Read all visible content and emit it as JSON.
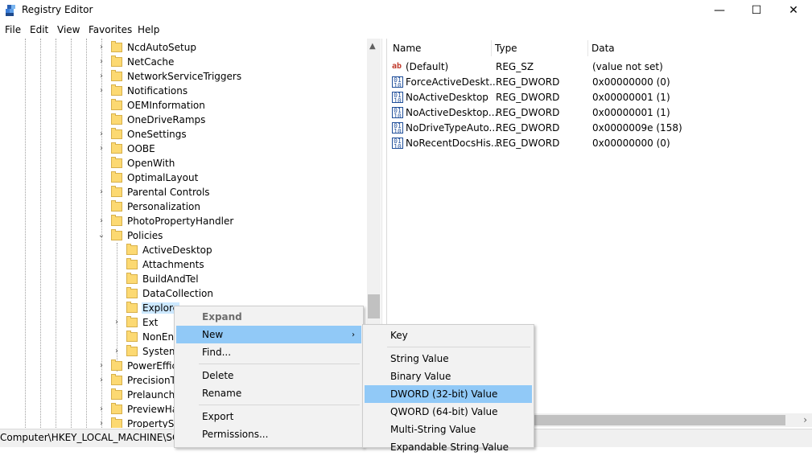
{
  "window": {
    "title": "Registry Editor",
    "minimize": "—",
    "maximize": "☐",
    "close": "✕"
  },
  "menubar": [
    "File",
    "Edit",
    "View",
    "Favorites",
    "Help"
  ],
  "tree": {
    "items": [
      {
        "label": "NcdAutoSetup",
        "expander": ">"
      },
      {
        "label": "NetCache",
        "expander": ">"
      },
      {
        "label": "NetworkServiceTriggers",
        "expander": ">"
      },
      {
        "label": "Notifications",
        "expander": ">"
      },
      {
        "label": "OEMInformation",
        "expander": ""
      },
      {
        "label": "OneDriveRamps",
        "expander": ""
      },
      {
        "label": "OneSettings",
        "expander": ">"
      },
      {
        "label": "OOBE",
        "expander": ">"
      },
      {
        "label": "OpenWith",
        "expander": ""
      },
      {
        "label": "OptimalLayout",
        "expander": ""
      },
      {
        "label": "Parental Controls",
        "expander": ">"
      },
      {
        "label": "Personalization",
        "expander": ""
      },
      {
        "label": "PhotoPropertyHandler",
        "expander": ">"
      },
      {
        "label": "Policies",
        "expander": "v"
      },
      {
        "label": "ActiveDesktop",
        "expander": ""
      },
      {
        "label": "Attachments",
        "expander": ""
      },
      {
        "label": "BuildAndTel",
        "expander": ""
      },
      {
        "label": "DataCollection",
        "expander": ""
      },
      {
        "label": "Explore",
        "expander": ""
      },
      {
        "label": "Ext",
        "expander": ">"
      },
      {
        "label": "NonEnu",
        "expander": ""
      },
      {
        "label": "System",
        "expander": ">"
      },
      {
        "label": "PowerEffici",
        "expander": ">"
      },
      {
        "label": "PrecisionTo",
        "expander": ">"
      },
      {
        "label": "Prelaunch",
        "expander": ""
      },
      {
        "label": "PreviewHar",
        "expander": ">"
      },
      {
        "label": "PropertySys",
        "expander": ">"
      }
    ]
  },
  "list": {
    "headers": {
      "name": "Name",
      "type": "Type",
      "data": "Data"
    },
    "rows": [
      {
        "icon": "string-value-icon",
        "name": "(Default)",
        "type": "REG_SZ",
        "data": "(value not set)"
      },
      {
        "icon": "dword-value-icon",
        "name": "ForceActiveDeskt...",
        "type": "REG_DWORD",
        "data": "0x00000000 (0)"
      },
      {
        "icon": "dword-value-icon",
        "name": "NoActiveDesktop",
        "type": "REG_DWORD",
        "data": "0x00000001 (1)"
      },
      {
        "icon": "dword-value-icon",
        "name": "NoActiveDesktop...",
        "type": "REG_DWORD",
        "data": "0x00000001 (1)"
      },
      {
        "icon": "dword-value-icon",
        "name": "NoDriveTypeAuto...",
        "type": "REG_DWORD",
        "data": "0x0000009e (158)"
      },
      {
        "icon": "dword-value-icon",
        "name": "NoRecentDocsHis...",
        "type": "REG_DWORD",
        "data": "0x00000000 (0)"
      }
    ]
  },
  "context_menu": {
    "expand": "Expand",
    "new": "New",
    "find": "Find...",
    "delete": "Delete",
    "rename": "Rename",
    "export": "Export",
    "permissions": "Permissions..."
  },
  "submenu": {
    "key": "Key",
    "string": "String Value",
    "binary": "Binary Value",
    "dword": "DWORD (32-bit) Value",
    "qword": "QWORD (64-bit) Value",
    "multistring": "Multi-String Value",
    "expandable": "Expandable String Value"
  },
  "statusbar": {
    "path": "Computer\\HKEY_LOCAL_MACHINE\\SOF"
  },
  "colors": {
    "highlight": "#91c9f7",
    "folder": "#fcd972",
    "selection": "#cce8ff"
  }
}
